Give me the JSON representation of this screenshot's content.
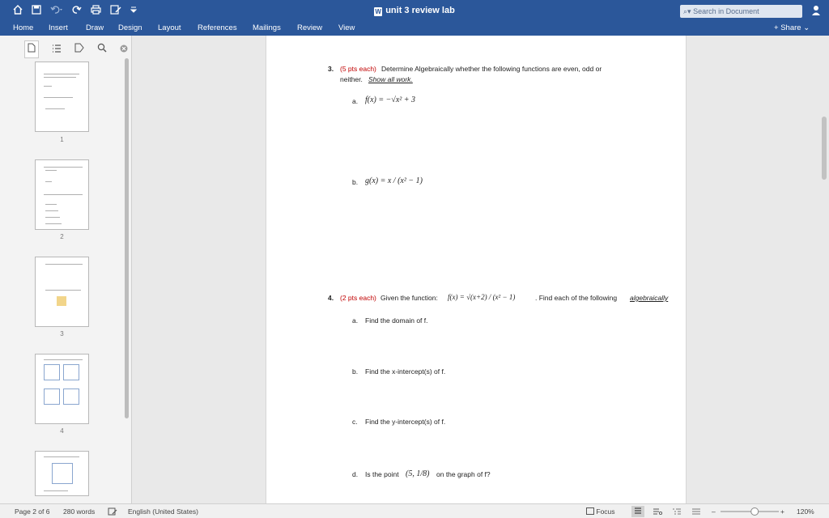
{
  "window": {
    "title": "unit 3 review lab",
    "search_placeholder": "Search in Document"
  },
  "ribbon": {
    "tabs": [
      "Home",
      "Insert",
      "Draw",
      "Design",
      "Layout",
      "References",
      "Mailings",
      "Review",
      "View"
    ],
    "share_label": "Share"
  },
  "thumbnails": [
    "1",
    "2",
    "3",
    "4"
  ],
  "document": {
    "q3": {
      "number": "3.",
      "points": "(5 pts each)",
      "text_line1": "Determine Algebraically whether the following functions are even, odd or",
      "text_line2_pre": "neither.",
      "text_line2_em": "Show all work.",
      "a_label": "a.",
      "a_expr": "f(x) = −√x² + 3",
      "b_label": "b.",
      "b_expr": "g(x) = x / (x² − 1)"
    },
    "q4": {
      "number": "4.",
      "points": "(2 pts each)",
      "text_pre": "Given the function:",
      "func": "f(x) = √(x+2) / (x² − 1)",
      "text_post": ". Find each of the following",
      "text_em": "algebraically",
      "a_label": "a.",
      "a_text": "Find the domain of f.",
      "b_label": "b.",
      "b_text": "Find the x-intercept(s) of f.",
      "c_label": "c.",
      "c_text": "Find the y-intercept(s) of f.",
      "d_label": "d.",
      "d_text_pre": "Is the point",
      "d_point": "(5, 1/8)",
      "d_text_post": "on the graph of f?"
    }
  },
  "status": {
    "page": "Page 2 of 6",
    "words": "280 words",
    "language": "English (United States)",
    "focus": "Focus",
    "zoom_level": "120%",
    "zoom_fraction": 0.6
  }
}
